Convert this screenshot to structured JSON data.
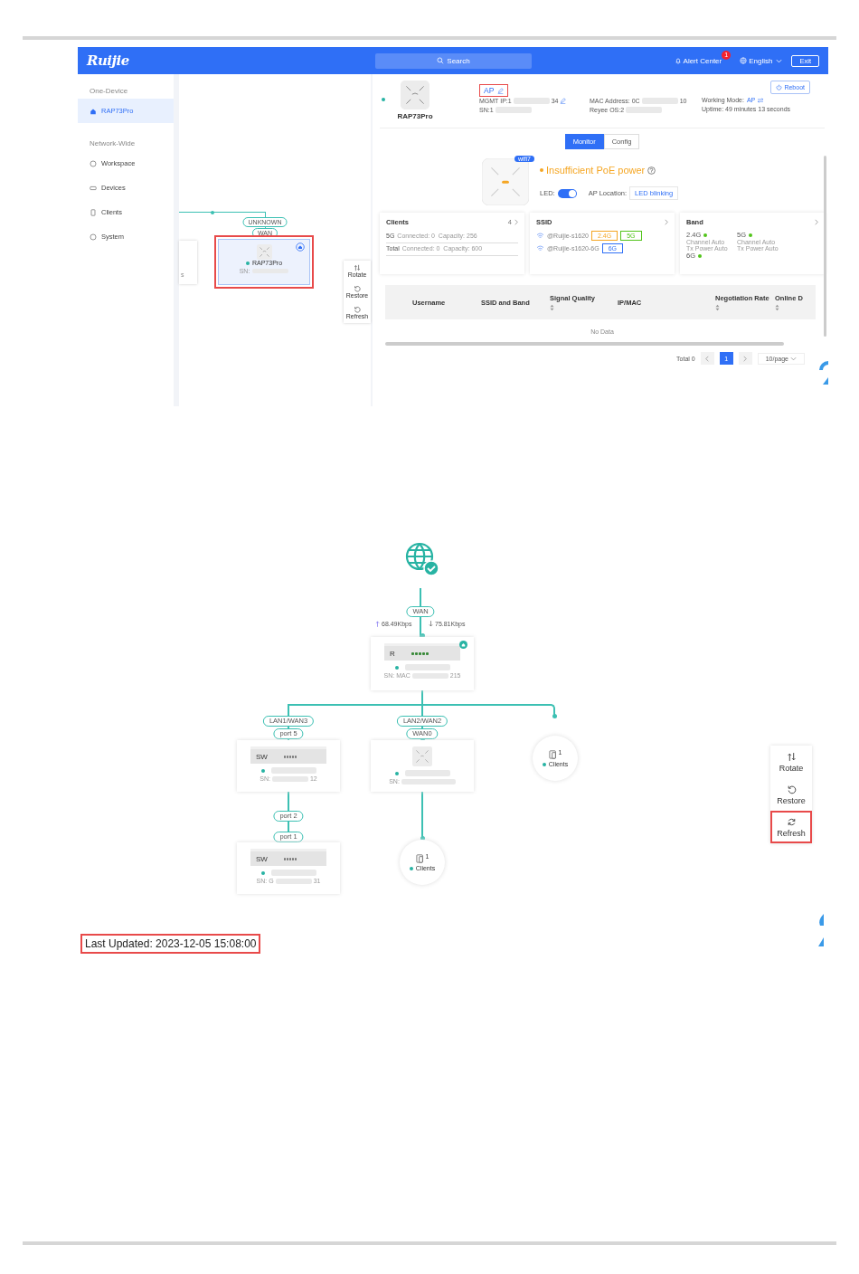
{
  "screenshot_1": {
    "header": {
      "logo": "Ruijie",
      "search_placeholder": "Search",
      "alert_center": "Alert Center",
      "alert_count": "1",
      "language": "English",
      "exit": "Exit"
    },
    "sidebar": [
      {
        "title": "One-Device",
        "items": [
          {
            "label": "RAP73Pro",
            "selected": true
          }
        ]
      },
      {
        "title": "Network-Wide",
        "items": [
          {
            "label": "Workspace",
            "selected": false
          },
          {
            "label": "Devices",
            "selected": false
          },
          {
            "label": "Clients",
            "selected": false
          },
          {
            "label": "System",
            "selected": false
          }
        ]
      }
    ],
    "topology": {
      "port_labels": [
        "UNKNOWN",
        "WAN"
      ],
      "node": {
        "name": "RAP73Pro",
        "sn": "SN:",
        "online": true,
        "highlighted": true
      },
      "partial_text": "s"
    },
    "tools": [
      {
        "label": "Rotate",
        "highlighted": false
      },
      {
        "label": "Restore",
        "highlighted": false
      },
      {
        "label": "Refresh",
        "highlighted": false
      }
    ],
    "device": {
      "type": "AP",
      "type_highlighted": true,
      "name": "RAP73Pro",
      "online": true,
      "fields": [
        {
          "text": "MGMT IP:1",
          "tail": "34",
          "editable": true
        },
        {
          "text": "SN:1",
          "editable": false
        },
        {
          "text": "MAC Address: 0C",
          "tail": "10",
          "editable": false
        },
        {
          "text": "Reyee OS:2",
          "editable": false
        }
      ],
      "working_mode_label": "Working Mode:",
      "working_mode": "AP",
      "uptime": "Uptime: 49 minutes 13 seconds",
      "reboot": "Reboot"
    },
    "tabs": [
      {
        "label": "Monitor",
        "selected": true
      },
      {
        "label": "Config",
        "selected": false
      }
    ],
    "status": {
      "badge": "wifi7",
      "message": "Insufficient PoE power",
      "led_label": "LED:",
      "led_on": true,
      "location_label": "AP Location:",
      "location_button": "LED blinking"
    },
    "cards": {
      "clients": {
        "title": "Clients",
        "count": "4",
        "lines": [
          {
            "label": "5G",
            "text": "Connected: 0  Capacity: 256"
          },
          {
            "label": "Total",
            "text": "Connected: 0  Capacity: 600"
          }
        ]
      },
      "ssid": {
        "title": "SSID",
        "items": [
          {
            "name": "@Ruijie-s1620",
            "bands": [
              {
                "label": "2.4G",
                "color": "#f5a623"
              },
              {
                "label": "5G",
                "color": "#52c41a"
              }
            ]
          },
          {
            "name": "@Ruijie-s1620-6G",
            "bands": [
              {
                "label": "6G",
                "color": "#2f6ff6"
              }
            ]
          }
        ]
      },
      "band": {
        "title": "Band",
        "items": [
          {
            "band": "2.4G",
            "online": true,
            "channel": "Channel Auto",
            "power": "Tx Power Auto"
          },
          {
            "band": "5G",
            "online": true,
            "channel": "Channel Auto",
            "power": "Tx Power Auto"
          },
          {
            "band": "6G",
            "online": true
          }
        ]
      }
    },
    "table": {
      "columns": [
        {
          "label": "Username",
          "sortable": false
        },
        {
          "label": "SSID and Band",
          "sortable": false
        },
        {
          "label": "Signal Quality",
          "sortable": true
        },
        {
          "label": "IP/MAC",
          "sortable": false
        },
        {
          "label": "Negotiation Rate",
          "sortable": true
        },
        {
          "label": "Online D",
          "sortable": true
        }
      ],
      "empty_text": "No Data"
    },
    "pagination": {
      "total": "Total 0",
      "pages": [
        {
          "label": "1",
          "selected": true
        }
      ],
      "page_size": "10/page"
    }
  },
  "screenshot_2": {
    "wan_label": "WAN",
    "upload": "68.49Kbps",
    "download": "75.81Kbps",
    "nodes": [
      {
        "kind": "router",
        "letter": "R",
        "sn": "SN: MAC",
        "sn_tail": "215",
        "online": true
      },
      {
        "kind": "switch",
        "letter": "SW",
        "sn": "SN:",
        "sn_tail": "12",
        "online": true
      },
      {
        "kind": "ap",
        "sn": "SN:",
        "online": true
      },
      {
        "kind": "clients",
        "count": "1",
        "label": "Clients",
        "online": true
      },
      {
        "kind": "switch",
        "letter": "SW",
        "sn": "SN: G",
        "sn_tail": "31",
        "online": true
      },
      {
        "kind": "clients",
        "count": "1",
        "label": "Clients",
        "online": true
      }
    ],
    "port_labels": [
      "LAN1/WAN3",
      "LAN2/WAN2",
      "port 5",
      "WAN0",
      "port 2",
      "port 1"
    ],
    "tools": [
      {
        "label": "Rotate",
        "highlighted": false
      },
      {
        "label": "Restore",
        "highlighted": false
      },
      {
        "label": "Refresh",
        "highlighted": true
      }
    ],
    "last_updated": {
      "text": "Last Updated: 2023-12-05 15:08:00",
      "highlighted": true
    }
  }
}
